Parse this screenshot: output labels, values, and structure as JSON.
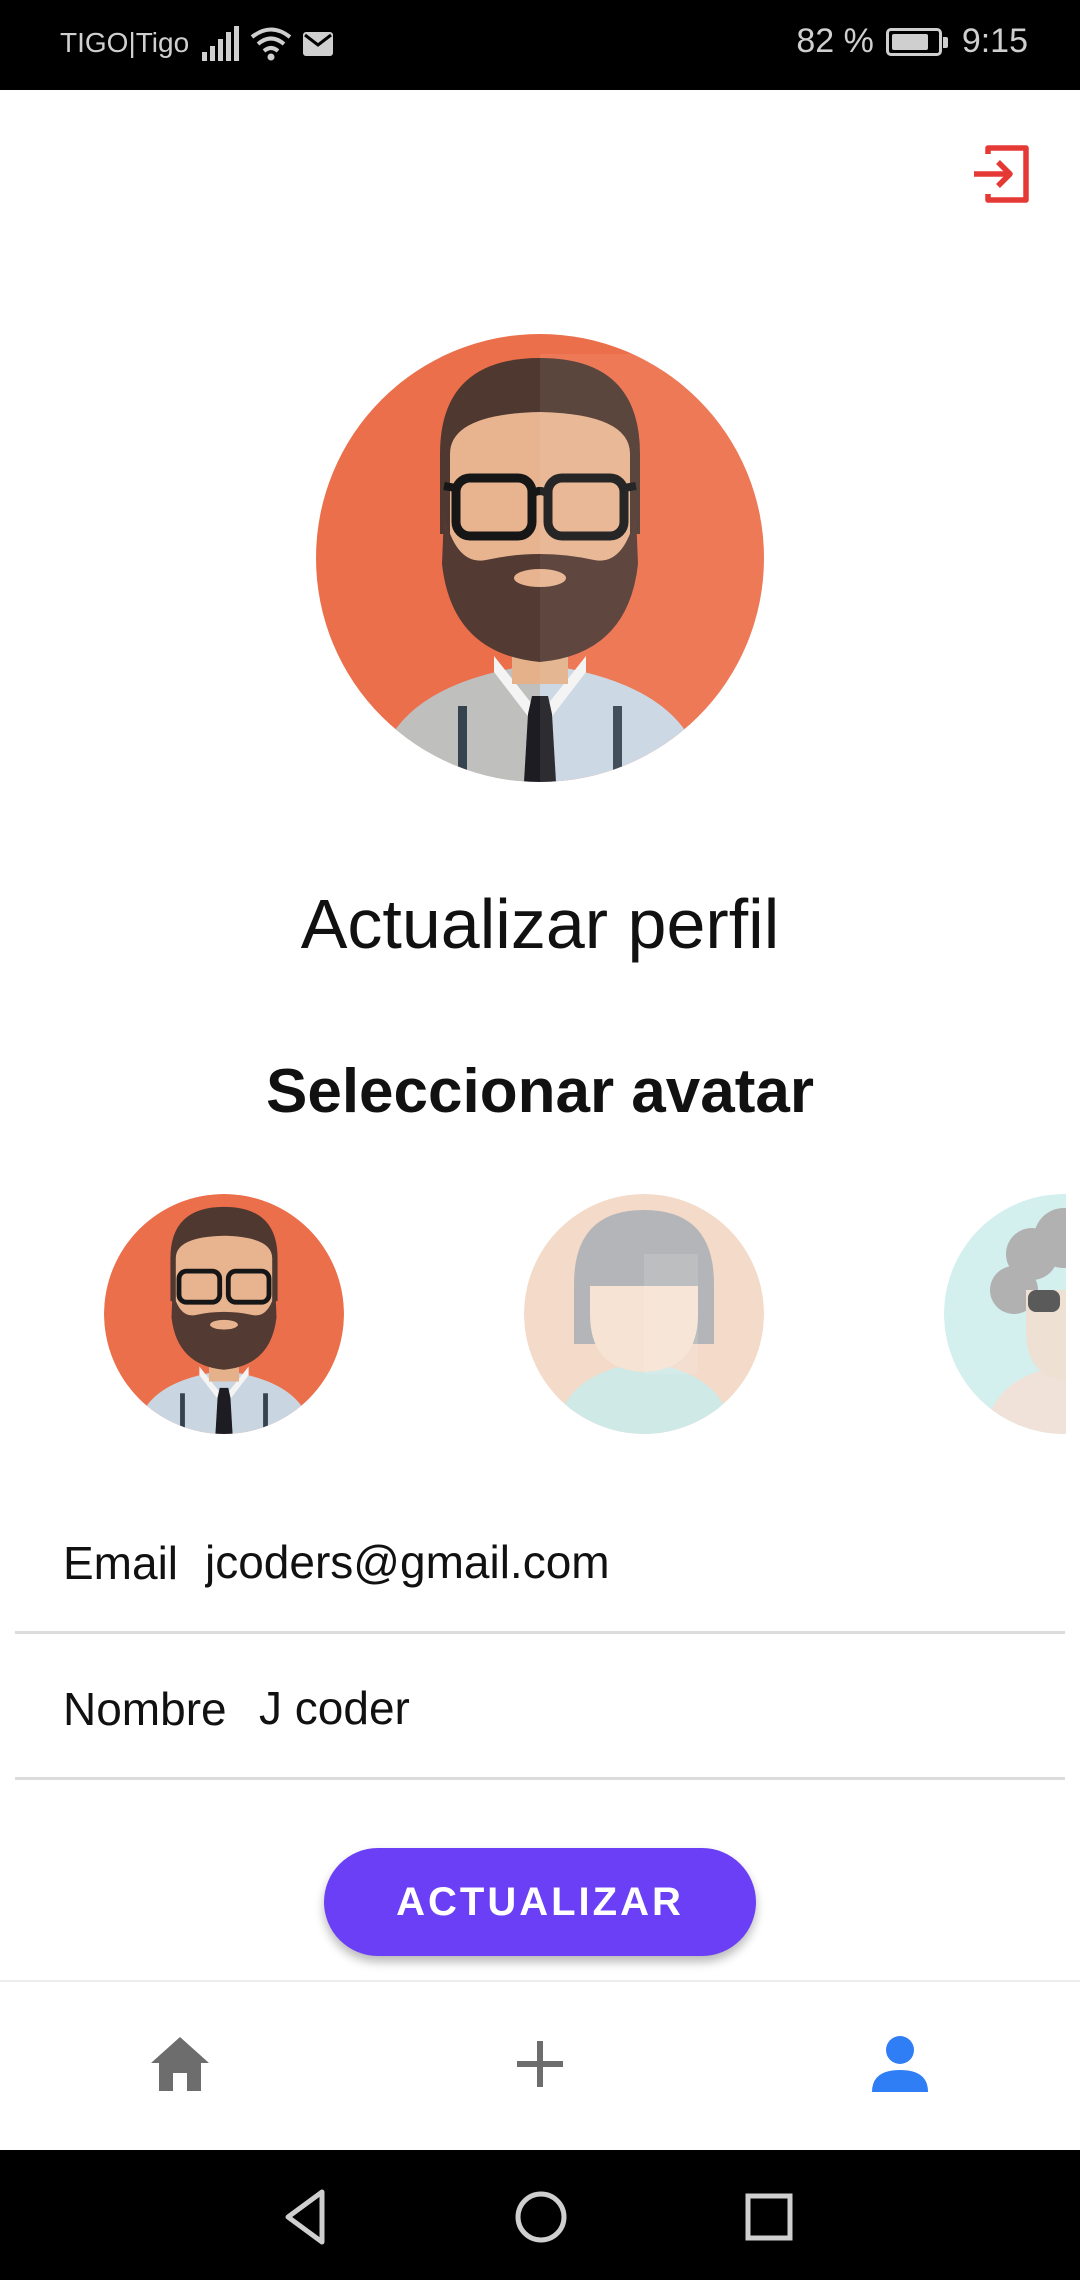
{
  "status_bar": {
    "carrier": "TIGO|Tigo",
    "battery": "82 %",
    "time": "9:15",
    "battery_level": 0.82
  },
  "profile": {
    "title": "Actualizar perfil",
    "avatar_section_title": "Seleccionar avatar",
    "avatars": [
      {
        "name": "bearded-man-avatar",
        "background": "#ec6f4b"
      },
      {
        "name": "woman-avatar",
        "background": "#f3dac9"
      },
      {
        "name": "curly-hair-avatar",
        "background": "#d3efee"
      }
    ]
  },
  "form": {
    "email_label": "Email",
    "email_value": "jcoders@gmail.com",
    "name_label": "Nombre",
    "name_value": "J coder",
    "submit_label": "ACTUALIZAR"
  },
  "bottom_nav": {
    "items": [
      {
        "icon": "home-icon",
        "active": false
      },
      {
        "icon": "add-icon",
        "active": false
      },
      {
        "icon": "person-icon",
        "active": true
      }
    ],
    "active_color": "#2f7ef6",
    "inactive_color": "#6d6d6d"
  },
  "colors": {
    "accent": "#6b3ff5",
    "logout": "#e53935"
  }
}
